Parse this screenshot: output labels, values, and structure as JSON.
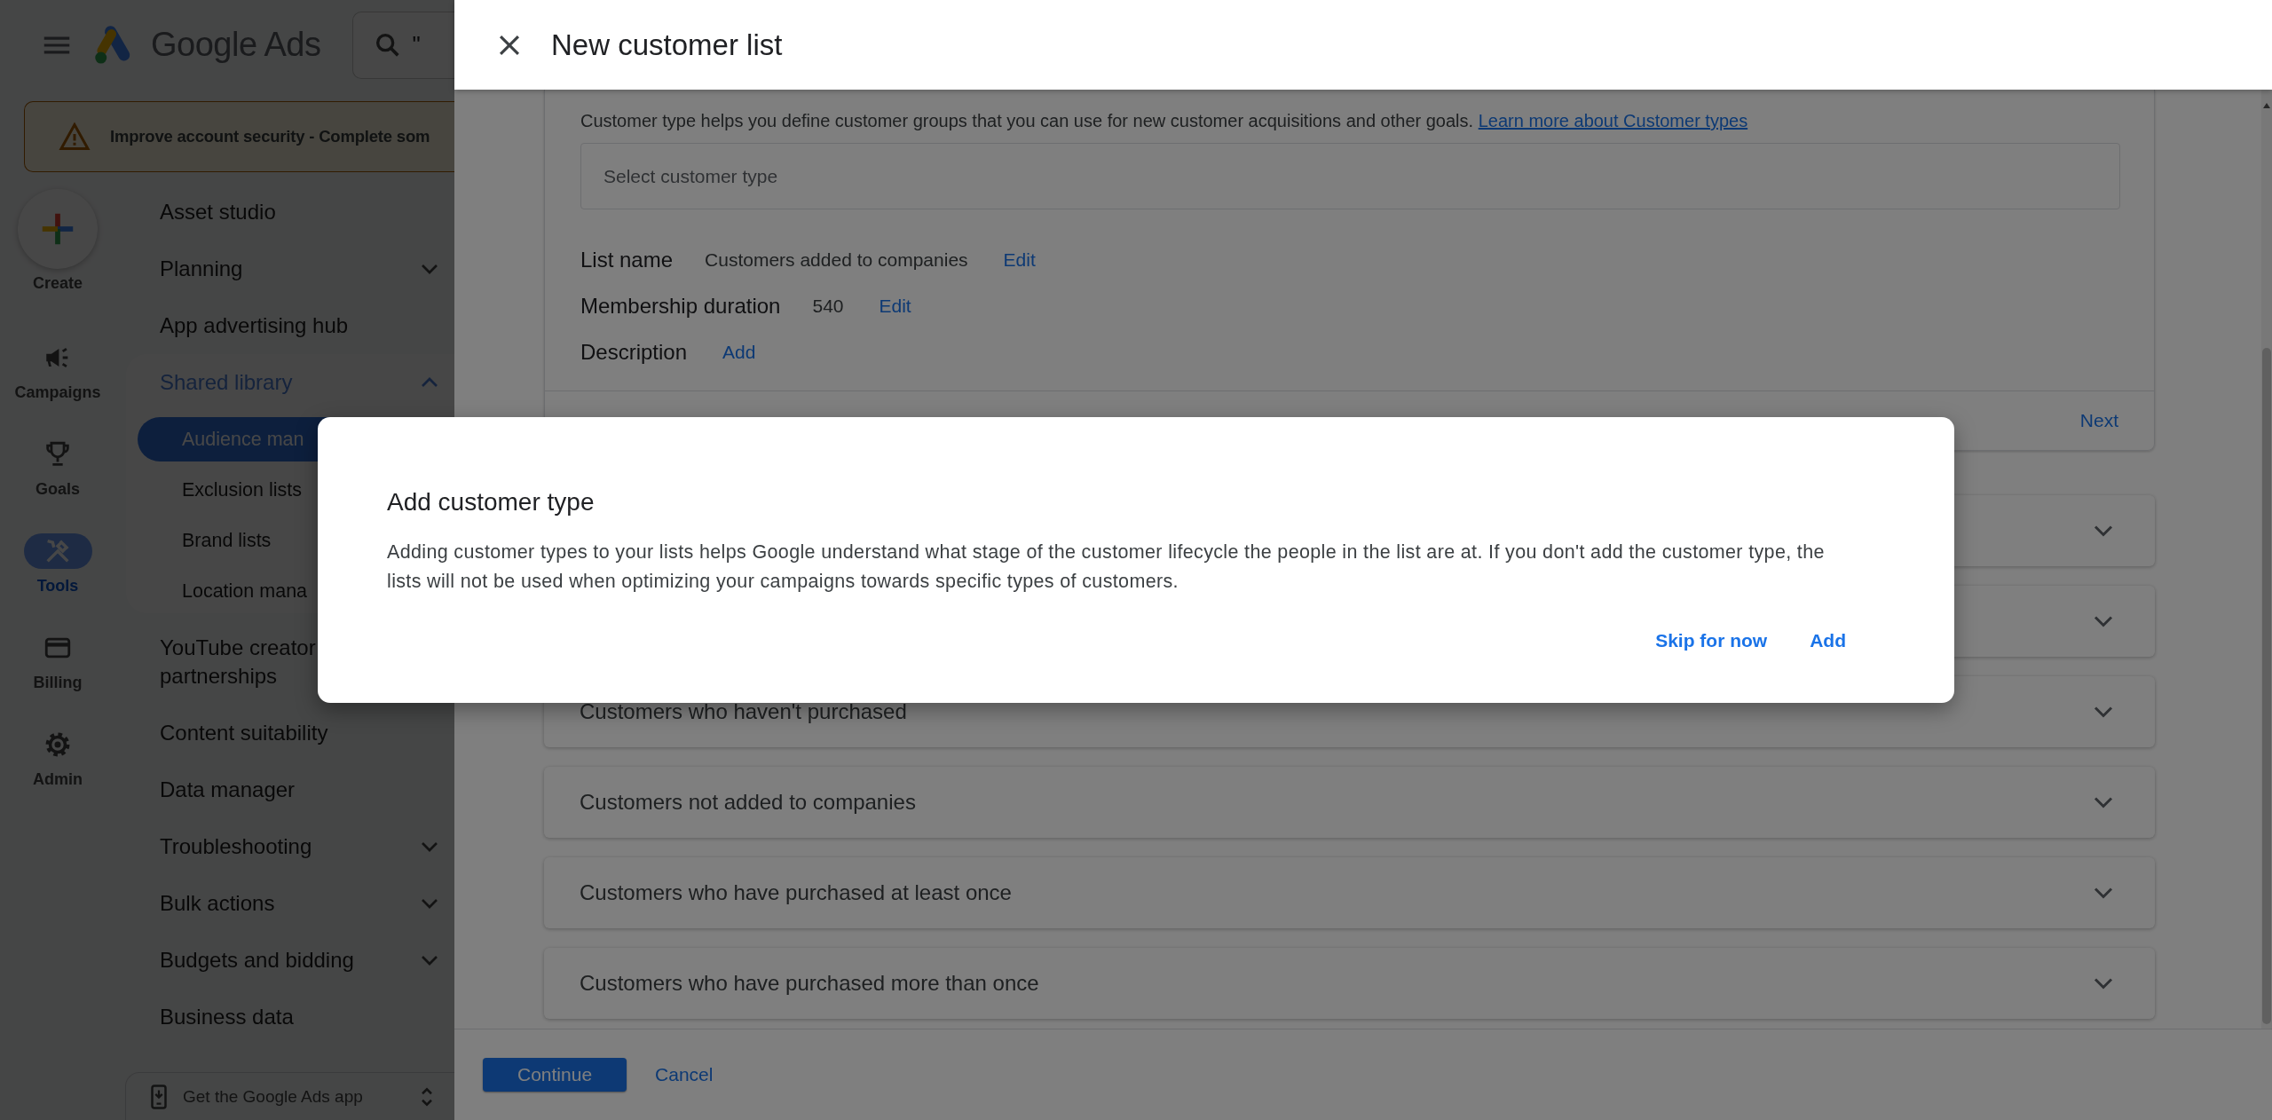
{
  "app": {
    "brand": "Google Ads",
    "search": {
      "value": "\""
    },
    "banner": "Improve account security - Complete som",
    "create_label": "Create",
    "rail": [
      {
        "label": "Campaigns",
        "selected": false
      },
      {
        "label": "Goals",
        "selected": false
      },
      {
        "label": "Tools",
        "selected": true
      },
      {
        "label": "Billing",
        "selected": false
      },
      {
        "label": "Admin",
        "selected": false
      }
    ],
    "nav": [
      {
        "kind": "link",
        "label": "Asset studio"
      },
      {
        "kind": "group",
        "label": "Planning",
        "expanded": false
      },
      {
        "kind": "link",
        "label": "App advertising hub"
      },
      {
        "kind": "group",
        "label": "Shared library",
        "expanded": true,
        "children": [
          {
            "label": "Audience man",
            "selected": true
          },
          {
            "label": "Exclusion lists",
            "selected": false
          },
          {
            "label": "Brand lists",
            "selected": false
          },
          {
            "label": "Location mana",
            "selected": false
          }
        ]
      },
      {
        "kind": "link",
        "label": "YouTube creator partnerships"
      },
      {
        "kind": "link",
        "label": "Content suitability"
      },
      {
        "kind": "link",
        "label": "Data manager"
      },
      {
        "kind": "group",
        "label": "Troubleshooting",
        "expanded": false
      },
      {
        "kind": "group",
        "label": "Bulk actions",
        "expanded": false
      },
      {
        "kind": "group",
        "label": "Budgets and bidding",
        "expanded": false
      },
      {
        "kind": "link",
        "label": "Business data"
      }
    ],
    "app_promo": "Get the Google Ads app"
  },
  "panel": {
    "title": "New customer list",
    "customer_type": {
      "description": "Customer type helps you define customer groups that you can use for new customer acquisitions and other goals.",
      "link": "Learn more about Customer types",
      "placeholder": "Select customer type"
    },
    "details": [
      {
        "label": "List name",
        "value": "Customers added to companies",
        "action": "Edit"
      },
      {
        "label": "Membership duration",
        "value": "540",
        "action": "Edit"
      },
      {
        "label": "Description",
        "action": "Add"
      }
    ],
    "next": "Next",
    "segments": [
      {
        "expanded": false
      },
      {
        "expanded": false
      },
      {
        "title": "Customers who haven't purchased",
        "expanded": false
      },
      {
        "title": "Customers not added to companies",
        "expanded": false
      },
      {
        "title": "Customers who have purchased at least once",
        "expanded": false
      },
      {
        "title": "Customers who have purchased more than once",
        "expanded": false
      }
    ],
    "buttons": {
      "primary": "Continue",
      "secondary": "Cancel"
    }
  },
  "dialog": {
    "title": "Add customer type",
    "body": "Adding customer types to your lists helps Google understand what stage of the customer lifecycle the people in the list are at. If you don't add the customer type, the lists will not be used when optimizing your campaigns towards specific types of customers.",
    "actions": [
      "Skip for now",
      "Add"
    ]
  }
}
